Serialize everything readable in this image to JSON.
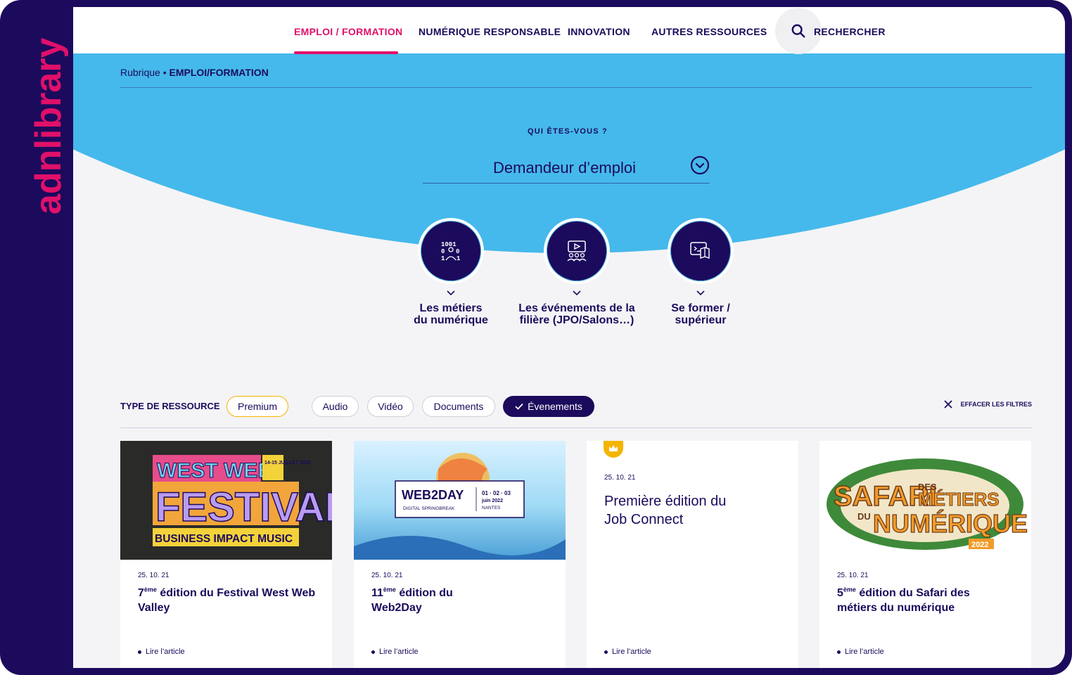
{
  "brand": {
    "logo_text": "adnlibrary",
    "accent": "#e0106a",
    "primary": "#1c0a5c",
    "sky": "#45b9eb",
    "premium": "#f4b400"
  },
  "nav": {
    "items": [
      "EMPLOI / FORMATION",
      "NUMÉRIQUE RESPONSABLE",
      "INNOVATION",
      "AUTRES RESSOURCES"
    ],
    "active_index": 0,
    "search_label": "RECHERCHER",
    "search_icon": "search-icon"
  },
  "breadcrumb": {
    "prefix": "Rubrique •",
    "current": "EMPLOI/FORMATION"
  },
  "profile": {
    "label": "QUI ÊTES-VOUS ?",
    "selected": "Demandeur d’emploi",
    "icon": "chevron-down-circle-icon"
  },
  "categories": [
    {
      "line1": "Les métiers",
      "line2": "du numérique",
      "icon": "binary-people-icon"
    },
    {
      "line1": "Les événements de la",
      "line2": "filière (JPO/Salons…)",
      "icon": "presentation-audience-icon"
    },
    {
      "line1": "Se former /",
      "line2": "supérieur",
      "icon": "screen-book-icon"
    }
  ],
  "filters": {
    "title": "TYPE DE RESSOURCE",
    "chips": [
      "Premium",
      "Audio",
      "Vidéo",
      "Documents",
      "Évenements"
    ],
    "active_chip": "Évenements",
    "clear_label": "EFFACER LES FILTRES"
  },
  "cards": [
    {
      "date": "25. 10. 21",
      "title_pre": "7",
      "title_sup": "ème",
      "title_post": " édition du Festival West Web Valley",
      "link": "Lire l’article",
      "image": {
        "line1": "WEST WEB",
        "line2": "FESTIVAL",
        "line3": "BUSINESS IMPACT MUSIC",
        "dates": "14-15 JUILLET 2022"
      }
    },
    {
      "date": "25. 10. 21",
      "title_pre": "11",
      "title_sup": "ème",
      "title_post": " édition du Web2Day",
      "link": "Lire l’article",
      "image": {
        "name": "WEB2DAY",
        "tagline": "DIGITAL SPRINGBREAK",
        "dates": "01 · 02 · 03",
        "month": "juin 2022",
        "city": "NANTES"
      }
    },
    {
      "date": "25. 10. 21",
      "title": "Première édition du Job Connect",
      "premium": true,
      "link": "Lire l’article"
    },
    {
      "date": "25. 10. 21",
      "title_pre": "5",
      "title_sup": "ème",
      "title_post": " édition du Safari des métiers du numérique",
      "link": "Lire l’article",
      "image": {
        "line1": "SAFARI",
        "des": "DES",
        "metiers": "MÉTIERS",
        "du": "DU",
        "line2": "NUMÉRIQUE",
        "year": "2022"
      }
    }
  ]
}
